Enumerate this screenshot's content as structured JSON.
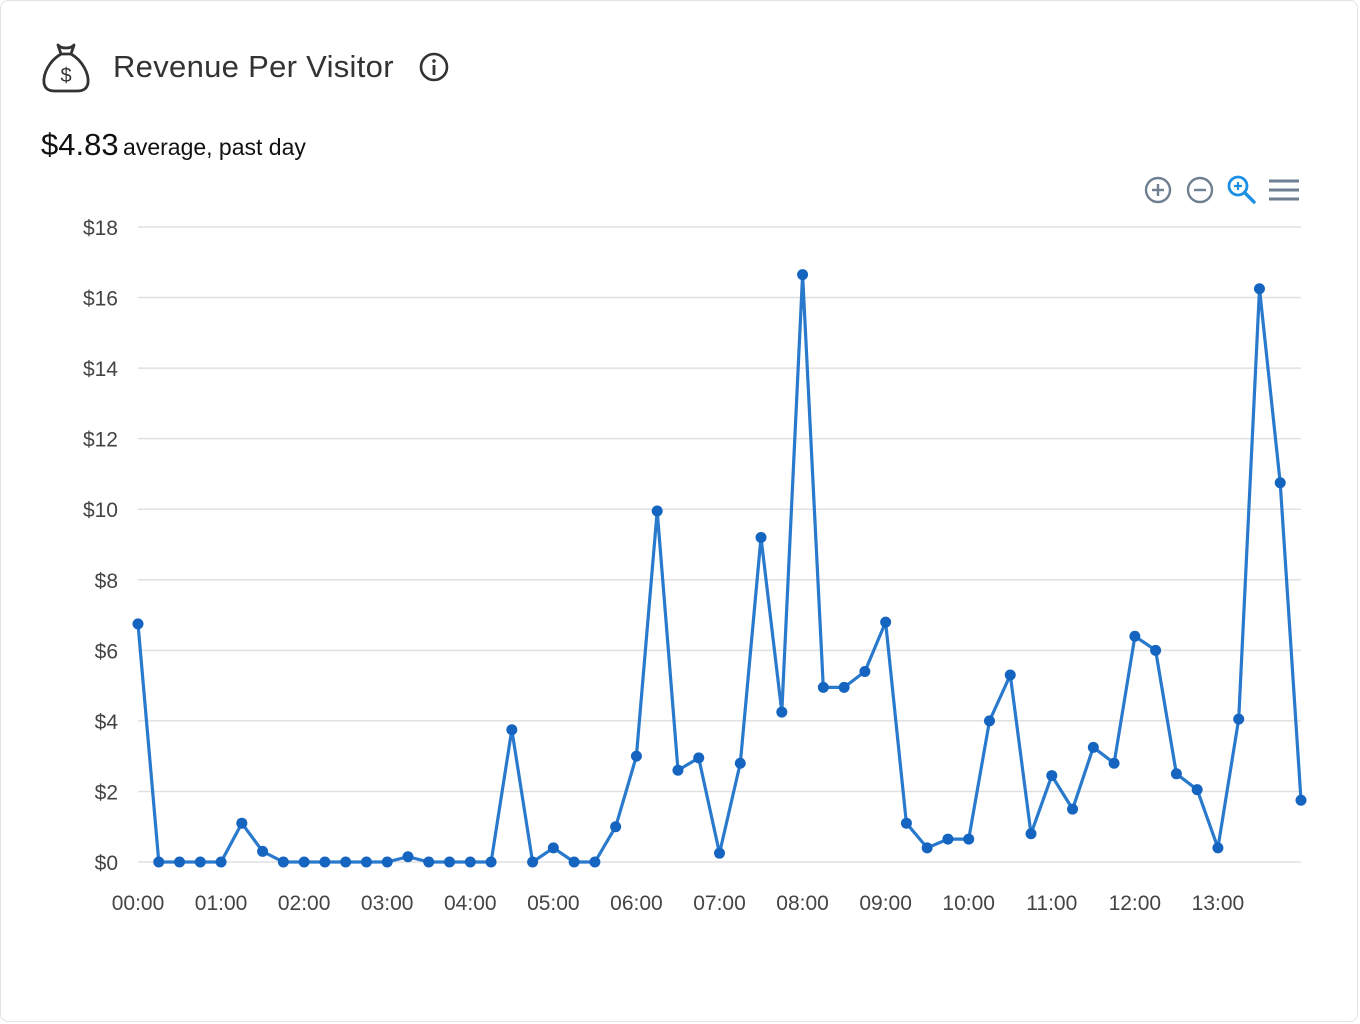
{
  "widget": {
    "title": "Revenue Per Visitor",
    "icon": "money-bag-icon",
    "info_icon": "info-icon"
  },
  "summary": {
    "value": "$4.83",
    "label": "average, past day"
  },
  "toolbar": {
    "zoom_in_icon": "zoom-in-icon",
    "zoom_out_icon": "zoom-out-icon",
    "zoom_select_icon": "zoom-select-icon",
    "menu_icon": "menu-icon",
    "active_color": "#1a8fe3"
  },
  "colors": {
    "line": "#2979cc",
    "point": "#1565c0",
    "grid": "#e0e0e0"
  },
  "chart_data": {
    "type": "line",
    "title": "",
    "xlabel": "",
    "ylabel": "",
    "ylim": [
      0,
      18
    ],
    "yticks": [
      0,
      2,
      4,
      6,
      8,
      10,
      12,
      14,
      16,
      18
    ],
    "ytick_labels": [
      "$0",
      "$2",
      "$4",
      "$6",
      "$8",
      "$10",
      "$12",
      "$14",
      "$16",
      "$18"
    ],
    "xlim_hours": [
      0,
      14
    ],
    "xtick_labels": [
      "00:00",
      "01:00",
      "02:00",
      "03:00",
      "04:00",
      "05:00",
      "06:00",
      "07:00",
      "08:00",
      "09:00",
      "10:00",
      "11:00",
      "12:00",
      "13:00"
    ],
    "grid": true,
    "interval_minutes": 15,
    "series": [
      {
        "values": [
          6.75,
          0,
          0,
          0,
          0,
          1.1,
          0.3,
          0,
          0,
          0,
          0,
          0,
          0,
          0.15,
          0,
          0,
          0,
          0,
          3.75,
          0,
          0.4,
          0,
          0,
          1.0,
          3.0,
          9.95,
          2.6,
          2.95,
          0.25,
          2.8,
          9.2,
          4.25,
          16.65,
          4.95,
          4.95,
          5.4,
          6.8,
          1.1,
          0.4,
          0.65,
          0.65,
          4.0,
          5.3,
          0.8,
          2.45,
          1.5,
          3.25,
          2.8,
          6.4,
          6.0,
          2.5,
          2.05,
          0.4,
          4.05,
          16.25,
          10.75,
          1.75
        ]
      }
    ]
  }
}
